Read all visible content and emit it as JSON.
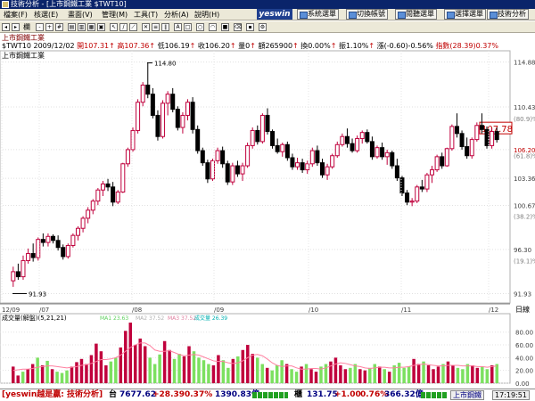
{
  "window": {
    "title": "技術分析 - [上市鋼鐵工業 $TWT10]"
  },
  "menubar": {
    "items": [
      "檔案(F)",
      "核選(E)",
      "畫面(V)",
      "管理(M)",
      "工具(T)",
      "分析(A)",
      "說明(H)"
    ],
    "logo": "yeswin",
    "buttons": [
      "系統選單",
      "切換帳號",
      "閱聽選單",
      "選擇選單",
      "技術分析"
    ]
  },
  "toolbar": {
    "label": "欄"
  },
  "info": {
    "line1": "上市鋼鐵工業",
    "id_date": "$TWT10 2009/12/02",
    "open": "開107.31",
    "high": "高107.36",
    "low": "低106.19",
    "close": "收106.20",
    "qty": "量0",
    "amount": "額265900",
    "turnover": "換0.00%",
    "amp": "振1.10%",
    "chg": "漲(-0.60)-0.56%",
    "idx": "指數(28.39)0.37%"
  },
  "chart_data": [
    {
      "type": "candlestick",
      "title": "上市鋼鐵工業",
      "y_ticks": [
        "114.88",
        "110.43",
        "106.20",
        "103.36",
        "100.67",
        "96.30",
        "91.93"
      ],
      "pct_labels": [
        "(80.9)%",
        "(61.8)%",
        "(38.2)%",
        "(19.1)%"
      ],
      "price_tag": "107.78",
      "x_ticks": [
        "12/09",
        "/07",
        "/08",
        "/09",
        "/10",
        "/11",
        "/12"
      ],
      "x_label": "日線",
      "annotations": [
        "114.80",
        "91.93"
      ],
      "ylim": [
        91.0,
        116.0
      ],
      "candles": [
        [
          93.2,
          94.6,
          92.6,
          94.1
        ],
        [
          94.1,
          94.9,
          93.3,
          93.6
        ],
        [
          93.6,
          95.7,
          93.3,
          95.2
        ],
        [
          95.2,
          96.4,
          94.9,
          95.9
        ],
        [
          95.9,
          96.9,
          95.1,
          95.5
        ],
        [
          95.5,
          97.5,
          95.2,
          97.3
        ],
        [
          97.3,
          97.9,
          96.6,
          97.0
        ],
        [
          97.0,
          97.9,
          96.6,
          97.6
        ],
        [
          97.6,
          97.8,
          96.9,
          97.2
        ],
        [
          97.2,
          97.7,
          96.2,
          96.5
        ],
        [
          96.5,
          96.8,
          95.3,
          95.6
        ],
        [
          95.6,
          96.9,
          95.4,
          96.7
        ],
        [
          96.7,
          97.9,
          96.5,
          97.7
        ],
        [
          97.7,
          98.6,
          97.2,
          98.4
        ],
        [
          98.4,
          99.6,
          98.0,
          99.4
        ],
        [
          99.4,
          100.5,
          98.9,
          100.2
        ],
        [
          100.2,
          101.3,
          99.8,
          101.1
        ],
        [
          101.1,
          102.4,
          100.7,
          102.2
        ],
        [
          102.2,
          103.1,
          101.6,
          102.8
        ],
        [
          102.8,
          103.3,
          102.1,
          102.5
        ],
        [
          102.5,
          103.0,
          100.6,
          101.0
        ],
        [
          101.0,
          102.2,
          100.8,
          102.0
        ],
        [
          102.0,
          104.9,
          101.9,
          104.8
        ],
        [
          104.8,
          106.4,
          104.5,
          106.2
        ],
        [
          106.2,
          108.4,
          106.0,
          108.1
        ],
        [
          108.1,
          111.2,
          107.8,
          110.9
        ],
        [
          110.9,
          112.9,
          110.5,
          112.6
        ],
        [
          112.6,
          114.8,
          111.3,
          111.7
        ],
        [
          111.7,
          112.3,
          109.3,
          109.6
        ],
        [
          109.6,
          110.1,
          107.1,
          107.5
        ],
        [
          107.5,
          111.1,
          107.3,
          110.8
        ],
        [
          110.8,
          112.0,
          109.6,
          111.7
        ],
        [
          111.7,
          112.3,
          109.9,
          110.2
        ],
        [
          110.2,
          110.5,
          108.1,
          108.4
        ],
        [
          108.4,
          109.9,
          107.8,
          109.6
        ],
        [
          109.6,
          111.2,
          109.1,
          110.9
        ],
        [
          110.9,
          111.4,
          107.8,
          108.2
        ],
        [
          108.2,
          108.6,
          105.8,
          106.1
        ],
        [
          106.1,
          106.4,
          104.6,
          104.9
        ],
        [
          104.9,
          105.2,
          102.9,
          103.3
        ],
        [
          103.3,
          105.3,
          103.1,
          105.1
        ],
        [
          105.1,
          106.4,
          104.8,
          106.1
        ],
        [
          106.1,
          106.5,
          104.4,
          104.8
        ],
        [
          104.8,
          105.1,
          102.7,
          103.0
        ],
        [
          103.0,
          104.9,
          102.7,
          104.6
        ],
        [
          104.6,
          105.1,
          103.5,
          103.8
        ],
        [
          103.8,
          104.9,
          103.1,
          104.6
        ],
        [
          104.6,
          106.9,
          104.4,
          106.6
        ],
        [
          106.6,
          108.4,
          106.3,
          108.1
        ],
        [
          108.1,
          108.6,
          106.7,
          107.0
        ],
        [
          107.0,
          109.8,
          106.8,
          109.6
        ],
        [
          109.6,
          110.3,
          107.7,
          108.0
        ],
        [
          108.0,
          108.2,
          106.3,
          106.6
        ],
        [
          106.6,
          107.3,
          105.8,
          106.0
        ],
        [
          106.0,
          106.9,
          105.5,
          106.7
        ],
        [
          106.7,
          107.0,
          105.1,
          105.4
        ],
        [
          105.4,
          105.8,
          104.2,
          104.5
        ],
        [
          104.5,
          105.4,
          104.2,
          104.9
        ],
        [
          104.9,
          105.3,
          103.9,
          104.2
        ],
        [
          104.2,
          105.1,
          103.8,
          104.8
        ],
        [
          104.8,
          106.4,
          104.5,
          106.1
        ],
        [
          106.1,
          106.6,
          104.6,
          104.9
        ],
        [
          104.9,
          105.3,
          103.4,
          103.7
        ],
        [
          103.7,
          104.8,
          103.2,
          104.5
        ],
        [
          104.5,
          105.8,
          104.3,
          105.6
        ],
        [
          105.6,
          107.0,
          105.4,
          106.7
        ],
        [
          106.7,
          107.8,
          106.5,
          107.5
        ],
        [
          107.5,
          108.3,
          106.4,
          106.8
        ],
        [
          106.8,
          107.3,
          105.9,
          106.1
        ],
        [
          106.1,
          107.6,
          105.9,
          107.3
        ],
        [
          107.3,
          108.1,
          106.8,
          107.9
        ],
        [
          107.9,
          108.2,
          106.8,
          107.0
        ],
        [
          107.0,
          107.5,
          105.2,
          105.5
        ],
        [
          105.5,
          106.6,
          105.3,
          106.4
        ],
        [
          106.4,
          106.9,
          105.2,
          105.5
        ],
        [
          105.5,
          106.2,
          104.7,
          105.9
        ],
        [
          105.9,
          106.1,
          104.3,
          104.6
        ],
        [
          104.6,
          105.3,
          103.1,
          103.4
        ],
        [
          103.4,
          103.6,
          101.6,
          101.9
        ],
        [
          101.9,
          102.2,
          100.7,
          101.0
        ],
        [
          101.0,
          101.4,
          100.6,
          101.1
        ],
        [
          101.1,
          102.7,
          100.9,
          102.5
        ],
        [
          102.5,
          103.2,
          102.0,
          102.3
        ],
        [
          102.3,
          103.9,
          102.0,
          103.7
        ],
        [
          103.7,
          104.6,
          102.9,
          104.2
        ],
        [
          104.2,
          105.7,
          104.0,
          105.5
        ],
        [
          105.5,
          105.9,
          104.3,
          104.6
        ],
        [
          104.6,
          106.4,
          104.5,
          106.3
        ],
        [
          106.3,
          108.7,
          106.1,
          108.5
        ],
        [
          108.5,
          109.8,
          107.4,
          107.8
        ],
        [
          107.8,
          108.1,
          106.2,
          106.5
        ],
        [
          106.5,
          107.4,
          105.3,
          105.6
        ],
        [
          105.6,
          107.4,
          105.3,
          107.2
        ],
        [
          107.2,
          108.9,
          107.0,
          108.6
        ],
        [
          108.6,
          109.8,
          107.8,
          108.2
        ],
        [
          108.2,
          108.5,
          106.3,
          106.6
        ],
        [
          106.6,
          108.3,
          106.3,
          108.0
        ],
        [
          108.0,
          108.4,
          106.9,
          107.2
        ]
      ]
    },
    {
      "type": "bar",
      "title": "成交量(解盤)(5,21,21)",
      "legend": [
        "MA1 23.63",
        "MA2 37.52",
        "MA3 37.52",
        "成交量 26.39"
      ],
      "y_ticks": [
        "80.00",
        "60.00",
        "40.00",
        "20.00",
        "0.00"
      ],
      "ylim": [
        0,
        95
      ],
      "values": [
        26,
        12,
        18,
        22,
        30,
        40,
        28,
        35,
        22,
        18,
        16,
        20,
        26,
        33,
        38,
        30,
        44,
        62,
        50,
        28,
        34,
        40,
        56,
        82,
        95,
        60,
        70,
        58,
        40,
        30,
        45,
        66,
        52,
        38,
        46,
        42,
        58,
        50,
        40,
        36,
        30,
        28,
        44,
        36,
        24,
        38,
        42,
        52,
        60,
        46,
        40,
        30,
        24,
        20,
        28,
        36,
        30,
        22,
        18,
        26,
        30,
        22,
        18,
        26,
        30,
        34,
        40,
        28,
        22,
        24,
        30,
        22,
        20,
        24,
        30,
        26,
        22,
        18,
        28,
        32,
        24,
        26,
        38,
        30,
        34,
        28,
        22,
        26,
        30,
        34,
        28,
        24,
        22,
        30,
        28,
        24,
        26,
        22,
        28,
        30
      ],
      "ma": [
        20,
        21,
        22,
        22,
        23,
        25,
        26,
        27,
        27,
        26,
        25,
        24,
        25,
        26,
        28,
        29,
        31,
        34,
        37,
        37,
        38,
        40,
        44,
        50,
        56,
        60,
        63,
        63,
        59,
        52,
        50,
        50,
        51,
        48,
        45,
        43,
        44,
        45,
        44,
        41,
        38,
        35,
        34,
        34,
        32,
        31,
        32,
        35,
        40,
        44,
        45,
        43,
        38,
        32,
        28,
        26,
        27,
        27,
        24,
        22,
        22,
        23,
        23,
        22,
        24,
        27,
        30,
        32,
        31,
        29,
        27,
        26,
        24,
        23,
        24,
        25,
        25,
        24,
        24,
        25,
        25,
        26,
        28,
        29,
        30,
        29,
        28,
        27,
        27,
        28,
        28,
        28,
        27,
        27,
        27,
        26,
        26,
        25,
        26,
        27
      ]
    }
  ],
  "status": {
    "brand": "[yeswin越是贏: 技術分析]",
    "twse_label": "台",
    "twse_idx": "7677.62",
    "twse_chg": "+28.39",
    "twse_pct": "0.37%",
    "twse_amt": "1390.83億",
    "otc_label": "櫃",
    "otc_idx": "131.75",
    "otc_chg": "+1.00",
    "otc_pct": "0.76%",
    "otc_amt": "366.32億",
    "tab": "上市鋼鐵",
    "time": "17:19:51"
  },
  "colors": {
    "up": "#c0003c",
    "down": "#000000",
    "vol_up": "#c0003c",
    "vol_down": "#7ce060",
    "ma": "#ff80a0"
  }
}
